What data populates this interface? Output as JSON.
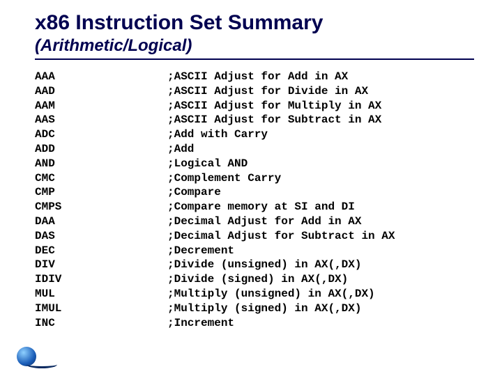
{
  "title": "x86 Instruction Set Summary",
  "subtitle": "(Arithmetic/Logical)",
  "instructions": [
    {
      "mnemonic": "AAA",
      "desc": ";ASCII Adjust for Add in AX"
    },
    {
      "mnemonic": "AAD",
      "desc": ";ASCII Adjust for Divide in AX"
    },
    {
      "mnemonic": "AAM",
      "desc": ";ASCII Adjust for Multiply in AX"
    },
    {
      "mnemonic": "AAS",
      "desc": ";ASCII Adjust for Subtract in AX"
    },
    {
      "mnemonic": "ADC",
      "desc": ";Add with Carry"
    },
    {
      "mnemonic": "ADD",
      "desc": ";Add"
    },
    {
      "mnemonic": "AND",
      "desc": ";Logical AND"
    },
    {
      "mnemonic": "CMC",
      "desc": ";Complement Carry"
    },
    {
      "mnemonic": "CMP",
      "desc": ";Compare"
    },
    {
      "mnemonic": "CMPS",
      "desc": ";Compare memory at SI and DI"
    },
    {
      "mnemonic": "DAA",
      "desc": ";Decimal Adjust for Add in AX"
    },
    {
      "mnemonic": "DAS",
      "desc": ";Decimal Adjust for Subtract in AX"
    },
    {
      "mnemonic": "DEC",
      "desc": ";Decrement"
    },
    {
      "mnemonic": "DIV",
      "desc": ";Divide (unsigned) in AX(,DX)"
    },
    {
      "mnemonic": "IDIV",
      "desc": ";Divide (signed) in AX(,DX)"
    },
    {
      "mnemonic": "MUL",
      "desc": ";Multiply (unsigned) in AX(,DX)"
    },
    {
      "mnemonic": "IMUL",
      "desc": ";Multiply (signed) in AX(,DX)"
    },
    {
      "mnemonic": "INC",
      "desc": ";Increment"
    }
  ]
}
